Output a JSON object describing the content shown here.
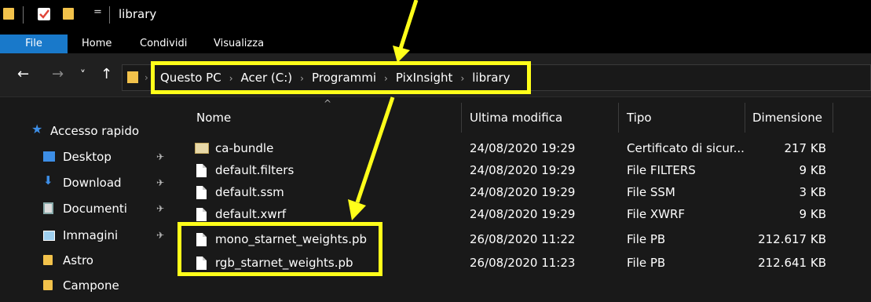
{
  "window": {
    "title": "library",
    "qat_dropdown": "="
  },
  "ribbon": {
    "tabs": [
      "File",
      "Home",
      "Condividi",
      "Visualizza"
    ]
  },
  "nav": {
    "back": "←",
    "forward": "→",
    "recent": "˅",
    "up": "↑"
  },
  "breadcrumb": [
    "Questo PC",
    "Acer (C:)",
    "Programmi",
    "PixInsight",
    "library"
  ],
  "sidebar": {
    "quick_access": "Accesso rapido",
    "items": [
      {
        "label": "Desktop",
        "icon": "desktop-icon",
        "pinned": true
      },
      {
        "label": "Download",
        "icon": "download-icon",
        "pinned": true
      },
      {
        "label": "Documenti",
        "icon": "documents-icon",
        "pinned": true
      },
      {
        "label": "Immagini",
        "icon": "pictures-icon",
        "pinned": true
      },
      {
        "label": "Astro",
        "icon": "folder-icon",
        "pinned": false
      },
      {
        "label": "Campone",
        "icon": "folder-icon",
        "pinned": false
      }
    ]
  },
  "columns": {
    "name": "Nome",
    "modified": "Ultima modifica",
    "type": "Tipo",
    "size": "Dimensione"
  },
  "files": [
    {
      "name": "ca-bundle",
      "modified": "24/08/2020 19:29",
      "type": "Certificato di sicur...",
      "size": "217 KB",
      "icon": "certificate-icon"
    },
    {
      "name": "default.filters",
      "modified": "24/08/2020 19:29",
      "type": "File FILTERS",
      "size": "9 KB",
      "icon": "file-icon"
    },
    {
      "name": "default.ssm",
      "modified": "24/08/2020 19:29",
      "type": "File SSM",
      "size": "3 KB",
      "icon": "file-icon"
    },
    {
      "name": "default.xwrf",
      "modified": "24/08/2020 19:29",
      "type": "File XWRF",
      "size": "9 KB",
      "icon": "file-icon"
    },
    {
      "name": "mono_starnet_weights.pb",
      "modified": "26/08/2020 11:22",
      "type": "File PB",
      "size": "212.617 KB",
      "icon": "file-icon"
    },
    {
      "name": "rgb_starnet_weights.pb",
      "modified": "26/08/2020 11:23",
      "type": "File PB",
      "size": "212.641 KB",
      "icon": "file-icon"
    }
  ],
  "colors": {
    "annotation": "#ffff1a",
    "ribbon_file": "#1979ca",
    "folder": "#f2c24b",
    "star": "#3d8ee6"
  }
}
